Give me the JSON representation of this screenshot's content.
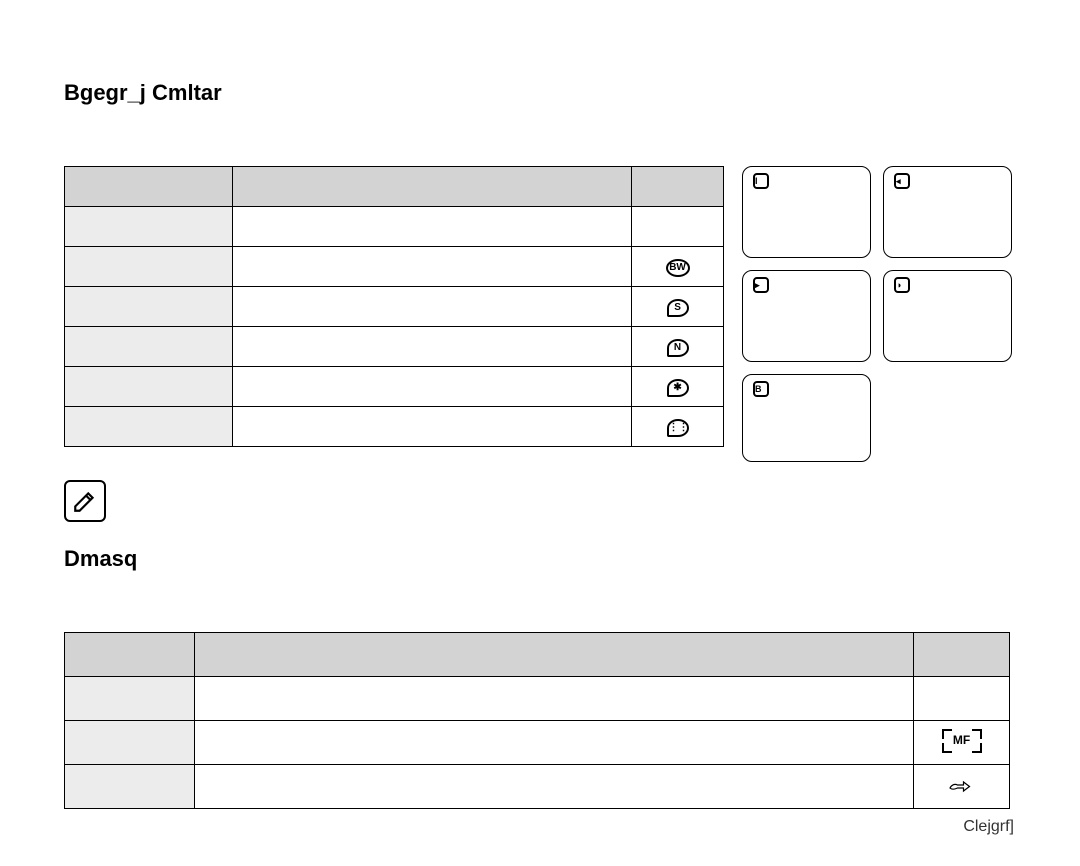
{
  "section1": {
    "heading": "Bgegr_j Cmltar",
    "table": {
      "headers": [
        "",
        "",
        ""
      ],
      "rows": [
        {
          "c1": "",
          "c2": "",
          "icon": ""
        },
        {
          "c1": "",
          "c2": "",
          "icon": "bw",
          "icon_label": "BW"
        },
        {
          "c1": "",
          "c2": "",
          "icon": "palette-s",
          "icon_label": "S"
        },
        {
          "c1": "",
          "c2": "",
          "icon": "palette-n",
          "icon_label": "N"
        },
        {
          "c1": "",
          "c2": "",
          "icon": "palette-star",
          "icon_label": "✱"
        },
        {
          "c1": "",
          "c2": "",
          "icon": "palette-grid",
          "icon_label": "⋮⋮"
        }
      ]
    },
    "cards": [
      {
        "label": "I"
      },
      {
        "label": "◂"
      },
      {
        "label": "▸"
      },
      {
        "label": "◑"
      },
      {
        "label": "B"
      }
    ]
  },
  "note_icon": "pencil",
  "section2": {
    "heading": "Dmasq",
    "table": {
      "headers": [
        "",
        "",
        ""
      ],
      "rows": [
        {
          "c1": "",
          "c2": "",
          "icon": ""
        },
        {
          "c1": "",
          "c2": "",
          "icon": "mf",
          "icon_label": "MF"
        },
        {
          "c1": "",
          "c2": "",
          "icon": "hand"
        }
      ]
    }
  },
  "footer": "Clejgrf]"
}
